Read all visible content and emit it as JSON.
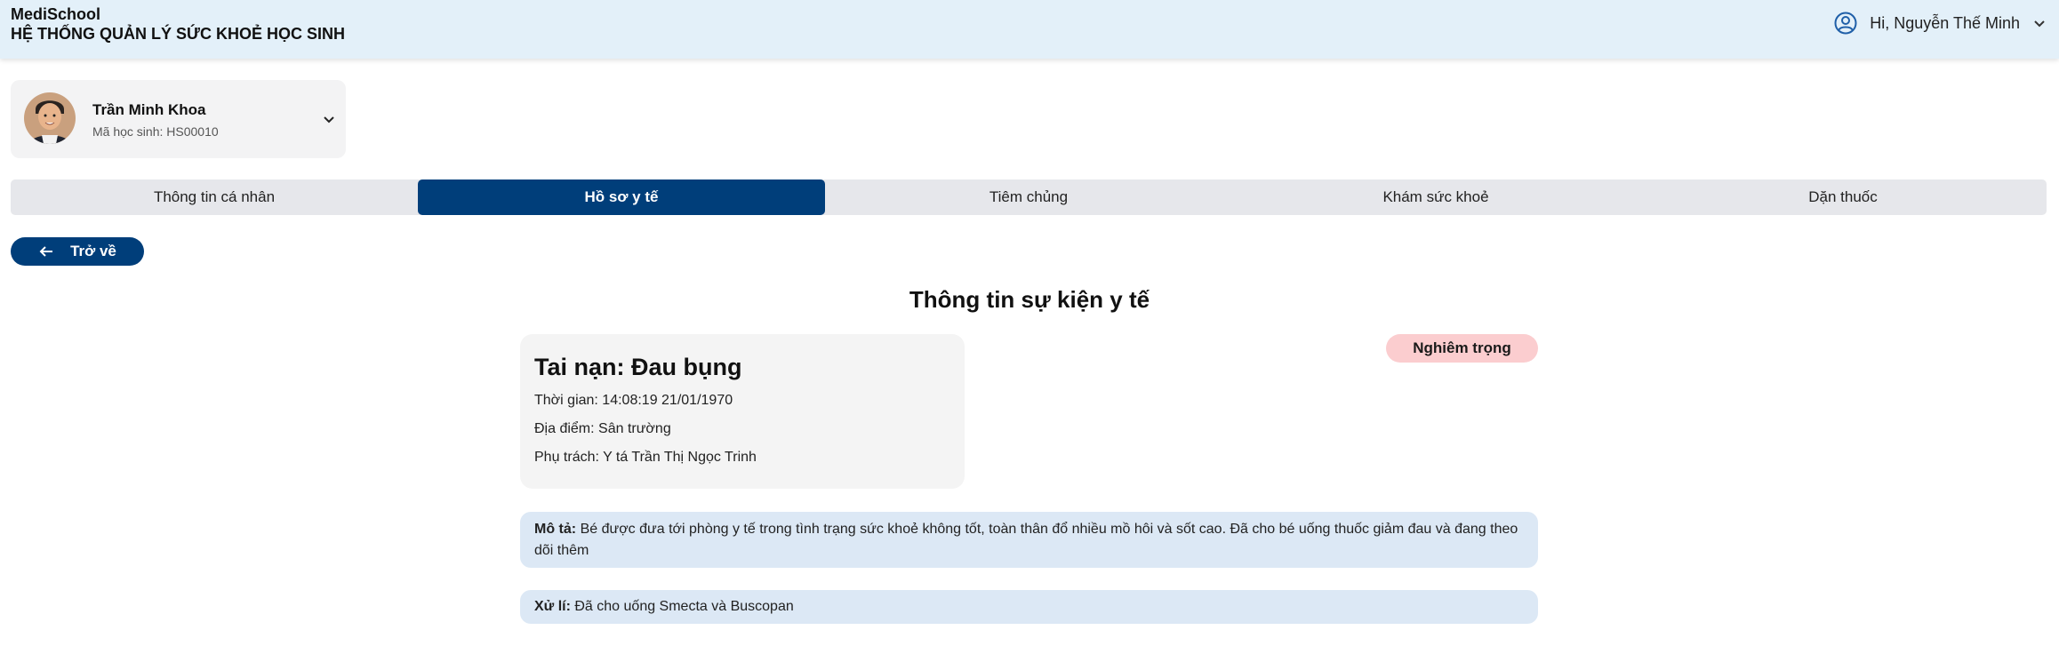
{
  "app": {
    "brand": "MediSchool",
    "subtitle": "HỆ THỐNG QUẢN LÝ SỨC KHOẺ HỌC SINH"
  },
  "user": {
    "greeting": "Hi, Nguyễn Thế Minh",
    "icon": "user-circle-icon"
  },
  "student": {
    "name": "Trần Minh Khoa",
    "code": "Mã học sinh: HS00010"
  },
  "tabs": [
    {
      "label": "Thông tin cá nhân",
      "active": false
    },
    {
      "label": "Hồ sơ y tế",
      "active": true
    },
    {
      "label": "Tiêm chủng",
      "active": false
    },
    {
      "label": "Khám sức khoẻ",
      "active": false
    },
    {
      "label": "Dặn thuốc",
      "active": false
    }
  ],
  "back_label": "Trở về",
  "page_title": "Thông tin sự kiện y tế",
  "event": {
    "title": "Tai nạn: Đau bụng",
    "time": "Thời gian: 14:08:19 21/01/1970",
    "location": "Địa điểm: Sân trường",
    "responsible": "Phụ trách: Y tá Trần Thị Ngọc Trinh",
    "severity": "Nghiêm trọng"
  },
  "description": {
    "label": "Mô tả:",
    "text": "Bé được đưa tới phòng y tế trong tình trạng sức khoẻ không tốt, toàn thân đổ nhiều mồ hôi và sốt cao. Đã cho bé uống thuốc giảm đau và đang theo dõi thêm"
  },
  "processing": {
    "label": "Xử lí:",
    "text": "Đã cho uống Smecta và Buscopan"
  },
  "colors": {
    "primary": "#003e7a",
    "header_bg": "#e3f0f9",
    "severity_bg": "#fbcdcf",
    "info_box_bg": "#dce8f5"
  }
}
